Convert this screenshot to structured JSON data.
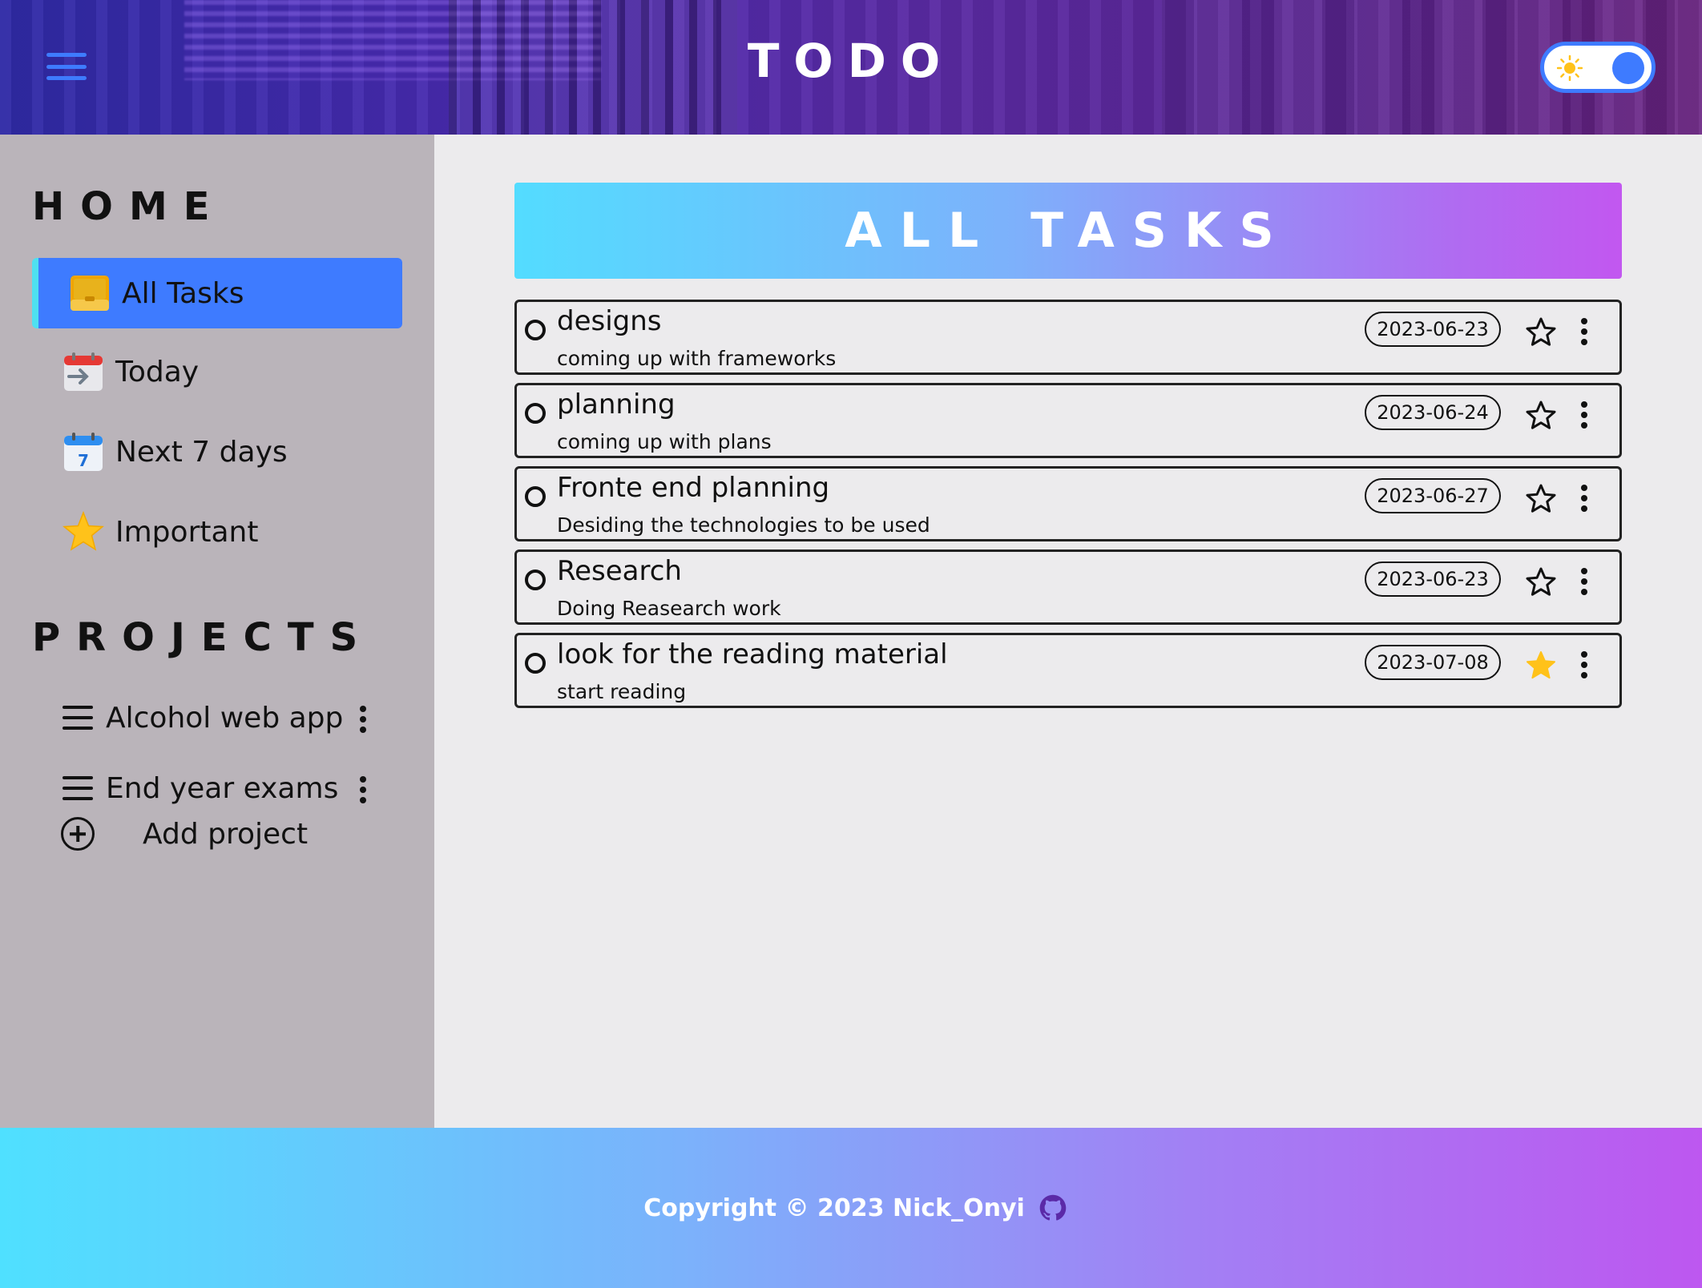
{
  "header": {
    "title": "TODO"
  },
  "sidebar": {
    "home_heading": "HOME",
    "nav": [
      {
        "label": "All Tasks"
      },
      {
        "label": "Today"
      },
      {
        "label": "Next 7 days"
      },
      {
        "label": "Important"
      }
    ],
    "projects_heading": "PROJECTS",
    "projects": [
      {
        "label": "Alcohol web app"
      },
      {
        "label": "End year exams"
      }
    ],
    "add_project_label": "Add project",
    "calendar_day": "7"
  },
  "main": {
    "banner_title": "ALL TASKS",
    "tasks": [
      {
        "title": "designs",
        "description": "coming up with frameworks",
        "date": "2023-06-23",
        "important": false
      },
      {
        "title": "planning",
        "description": "coming up with plans",
        "date": "2023-06-24",
        "important": false
      },
      {
        "title": "Fronte end planning",
        "description": "Desiding the technologies to be used",
        "date": "2023-06-27",
        "important": false
      },
      {
        "title": "Research",
        "description": "Doing Reasearch work",
        "date": "2023-06-23",
        "important": false
      },
      {
        "title": "look for the reading material",
        "description": "start reading",
        "date": "2023-07-08",
        "important": true
      }
    ]
  },
  "footer": {
    "copyright": "Copyright © 2023 Nick_Onyi"
  },
  "colors": {
    "accent": "#3e7bff",
    "star_filled": "#ffc21a"
  }
}
